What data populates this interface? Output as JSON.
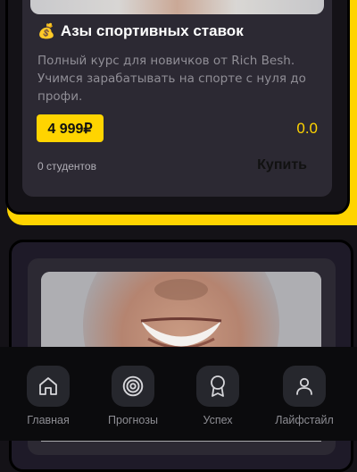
{
  "course": {
    "emoji": "💰",
    "title": "Азы спортивных ставок",
    "description": "Полный курс для новичков от Rich Besh. Учимся зарабатывать на спорте с нуля до профи.",
    "price": "4 999₽",
    "rating": "0.0",
    "students": "0 студентов",
    "buy_label": "Купить"
  },
  "bottom_nav": {
    "items": [
      {
        "label": "Главная",
        "icon": "home-icon"
      },
      {
        "label": "Прогнозы",
        "icon": "target-icon"
      },
      {
        "label": "Успех",
        "icon": "award-icon"
      },
      {
        "label": "Лайфстайл",
        "icon": "user-icon"
      }
    ]
  },
  "colors": {
    "accent": "#ffd400",
    "background": "#141217",
    "card": "#2c2933",
    "nav_background": "#0b0b0d"
  }
}
